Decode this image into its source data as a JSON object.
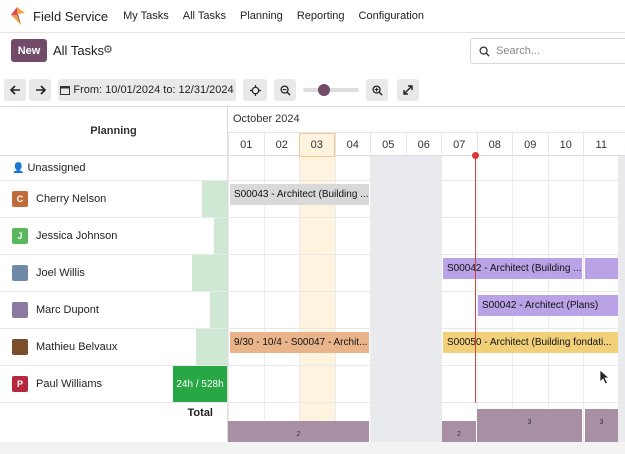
{
  "navbar": {
    "app_name": "Field Service",
    "menu": [
      "My Tasks",
      "All Tasks",
      "Planning",
      "Reporting",
      "Configuration"
    ]
  },
  "control": {
    "new_label": "New",
    "breadcrumb": "All Tasks",
    "search_placeholder": "Search..."
  },
  "toolbar": {
    "date_range": "From: 10/01/2024 to: 12/31/2024",
    "zoom_level": 0.35
  },
  "gantt": {
    "header_label": "Planning",
    "month": "October 2024",
    "days": [
      "01",
      "02",
      "03",
      "04",
      "05",
      "06",
      "07",
      "08",
      "09",
      "10",
      "11"
    ],
    "rows": [
      {
        "name": "Unassigned",
        "initial": "",
        "color": ""
      },
      {
        "name": "Cherry Nelson",
        "initial": "C",
        "color": "#c26b3a"
      },
      {
        "name": "Jessica Johnson",
        "initial": "J",
        "color": "#5cb85c"
      },
      {
        "name": "Joel Willis",
        "initial": "",
        "color": "#6e8aa8"
      },
      {
        "name": "Marc Dupont",
        "initial": "",
        "color": "#8c7aa3"
      },
      {
        "name": "Mathieu Belvaux",
        "initial": "",
        "color": "#7a4e2a"
      },
      {
        "name": "Paul Williams",
        "initial": "P",
        "color": "#b5283c"
      }
    ],
    "paul_load": "24h / 528h",
    "pills": [
      {
        "text": "S00043 - Architect (Building ...",
        "color": "#d9d9d9"
      },
      {
        "text": "S00042 - Architect (Building ...",
        "color": "#b9a3e6"
      },
      {
        "text": "S00042 - Architect (Plans)",
        "color": "#b9a3e6"
      },
      {
        "text": "9/30 - 10/4 - S00047 - Archit...",
        "color": "#eab48a"
      },
      {
        "text": "S00050 - Architect (Building fondati...",
        "color": "#f2d07a"
      }
    ],
    "total_label": "Total",
    "totals": [
      "2",
      "2",
      "3",
      "3"
    ]
  },
  "colors": {
    "brand": "#714b67",
    "today": "#d33333",
    "full_load": "#28a745"
  }
}
